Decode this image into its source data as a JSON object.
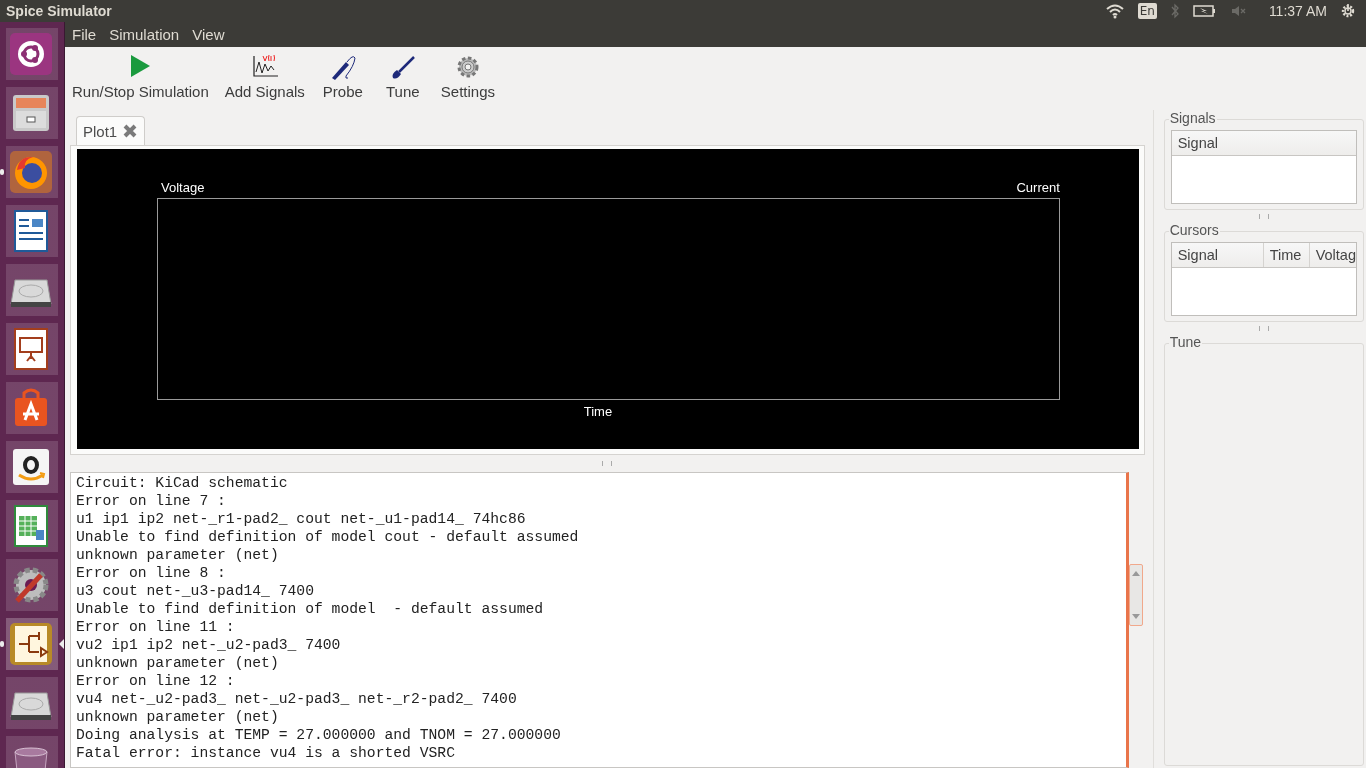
{
  "window": {
    "title": "Spice Simulator"
  },
  "indicators": {
    "keyboard": "En",
    "time": "11:37 AM"
  },
  "launcher": [
    {
      "kind": "ubuntu",
      "running": false,
      "focused": false
    },
    {
      "kind": "files",
      "running": false,
      "focused": false
    },
    {
      "kind": "firefox",
      "running": true,
      "focused": false
    },
    {
      "kind": "writer",
      "running": false,
      "focused": false
    },
    {
      "kind": "drive",
      "running": false,
      "focused": false
    },
    {
      "kind": "impress",
      "running": false,
      "focused": false
    },
    {
      "kind": "store",
      "running": false,
      "focused": false
    },
    {
      "kind": "amazon",
      "running": false,
      "focused": false
    },
    {
      "kind": "calc",
      "running": false,
      "focused": false
    },
    {
      "kind": "tools",
      "running": false,
      "focused": false
    },
    {
      "kind": "kicad",
      "running": true,
      "focused": true
    },
    {
      "kind": "drive",
      "running": false,
      "focused": false
    },
    {
      "kind": "trash",
      "running": false,
      "focused": false
    }
  ],
  "menu": [
    "File",
    "Simulation",
    "View"
  ],
  "toolbar": [
    {
      "kind": "run",
      "label": "Run/Stop Simulation"
    },
    {
      "kind": "signals",
      "label": "Add Signals"
    },
    {
      "kind": "probe",
      "label": "Probe"
    },
    {
      "kind": "tune",
      "label": "Tune"
    },
    {
      "kind": "settings",
      "label": "Settings"
    }
  ],
  "tabs": [
    {
      "label": "Plot1",
      "selected": true
    }
  ],
  "plot": {
    "left_axis": "Voltage",
    "right_axis": "Current",
    "x_axis": "Time"
  },
  "console": [
    "Circuit: KiCad schematic",
    "Error on line 7 :",
    "u1 ip1 ip2 net-_r1-pad2_ cout net-_u1-pad14_ 74hc86",
    "Unable to find definition of model cout - default assumed",
    "unknown parameter (net)",
    "Error on line 8 :",
    "u3 cout net-_u3-pad14_ 7400",
    "Unable to find definition of model  - default assumed",
    "Error on line 11 :",
    "vu2 ip1 ip2 net-_u2-pad3_ 7400",
    "unknown parameter (net)",
    "Error on line 12 :",
    "vu4 net-_u2-pad3_ net-_u2-pad3_ net-_r2-pad2_ 7400",
    "unknown parameter (net)",
    "Doing analysis at TEMP = 27.000000 and TNOM = 27.000000",
    "Fatal error: instance vu4 is a shorted VSRC"
  ],
  "signals_panel": {
    "title": "Signals",
    "columns": [
      "Signal"
    ]
  },
  "cursors_panel": {
    "title": "Cursors",
    "columns": [
      "Signal",
      "Time",
      "Voltag"
    ]
  },
  "tune_panel": {
    "title": "Tune"
  }
}
